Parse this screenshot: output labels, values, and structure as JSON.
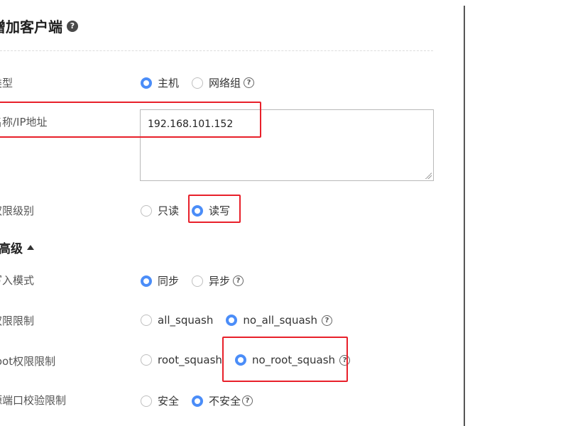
{
  "dialog": {
    "title": "增加客户端",
    "help_icon": "question-circle-icon"
  },
  "form": {
    "type": {
      "label": "类型",
      "options": [
        "主机",
        "网络组"
      ],
      "selected": "主机"
    },
    "name_ip": {
      "label": "名称/IP地址",
      "value": "192.168.101.152"
    },
    "permission_level": {
      "label": "权限级别",
      "options": [
        "只读",
        "读写"
      ],
      "selected": "读写"
    }
  },
  "advanced": {
    "label": "高级",
    "write_mode": {
      "label": "写入模式",
      "options": [
        "同步",
        "异步"
      ],
      "selected": "同步"
    },
    "permission_limit": {
      "label": "权限限制",
      "options": [
        "all_squash",
        "no_all_squash"
      ],
      "selected": "no_all_squash"
    },
    "root_permission_limit": {
      "label": "root权限限制",
      "options": [
        "root_squash",
        "no_root_squash"
      ],
      "selected": "no_root_squash"
    },
    "source_port_check": {
      "label": "源端口校验限制",
      "options": [
        "安全",
        "不安全"
      ],
      "selected": "不安全"
    }
  },
  "colors": {
    "accent": "#4b8df8",
    "highlight": "#e8202a"
  }
}
